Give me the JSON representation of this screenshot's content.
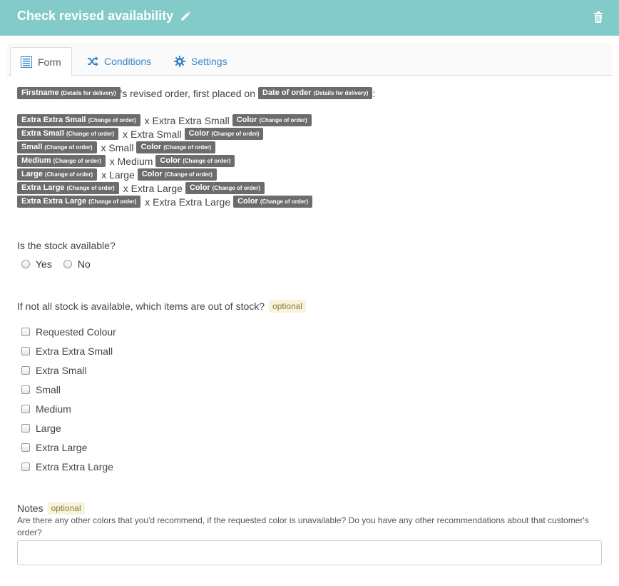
{
  "header": {
    "title": "Check revised availability",
    "bg_color": "#82cbc9"
  },
  "tabs": [
    {
      "label": "Form",
      "icon": "form-icon"
    },
    {
      "label": "Conditions",
      "icon": "shuffle-icon"
    },
    {
      "label": "Settings",
      "icon": "gear-icon"
    }
  ],
  "intro": {
    "tag1": {
      "main": "Firstname",
      "sub": "(Details for delivery)"
    },
    "text": "'s revised order, first placed on",
    "tag2": {
      "main": "Date of order",
      "sub": "(Details for delivery)"
    },
    "end": ":"
  },
  "order_lines": [
    {
      "tag": "Extra Extra Small",
      "sub": "(Change of order)",
      "text": "x Extra Extra Small",
      "color_tag": "Color",
      "color_sub": "(Change of order)"
    },
    {
      "tag": "Extra Small",
      "sub": "(Change of order)",
      "text": "x Extra Small",
      "color_tag": "Color",
      "color_sub": "(Change of order)"
    },
    {
      "tag": "Small",
      "sub": "(Change of order)",
      "text": "x Small",
      "color_tag": "Color",
      "color_sub": "(Change of order)"
    },
    {
      "tag": "Medium",
      "sub": "(Change of order)",
      "text": "x Medium",
      "color_tag": "Color",
      "color_sub": "(Change of order)"
    },
    {
      "tag": "Large",
      "sub": "(Change of order)",
      "text": "x Large",
      "color_tag": "Color",
      "color_sub": "(Change of order)"
    },
    {
      "tag": "Extra Large",
      "sub": "(Change of order)",
      "text": "x Extra Large",
      "color_tag": "Color",
      "color_sub": "(Change of order)"
    },
    {
      "tag": "Extra Extra Large",
      "sub": "(Change of order)",
      "text": "x Extra Extra Large",
      "color_tag": "Color",
      "color_sub": "(Change of order)"
    }
  ],
  "stock_question": {
    "label": "Is the stock available?",
    "options": [
      "Yes",
      "No"
    ]
  },
  "out_of_stock": {
    "label": "If not all stock is available, which items are out of stock?",
    "optional": "optional",
    "items": [
      "Requested Colour",
      "Extra Extra Small",
      "Extra Small",
      "Small",
      "Medium",
      "Large",
      "Extra Large",
      "Extra Extra Large"
    ]
  },
  "notes": {
    "label": "Notes",
    "optional": "optional",
    "help": "Are there any other colors that you'd recommend, if the requested color is unavailable? Do you have any other recommendations about that customer's order?",
    "value": ""
  }
}
